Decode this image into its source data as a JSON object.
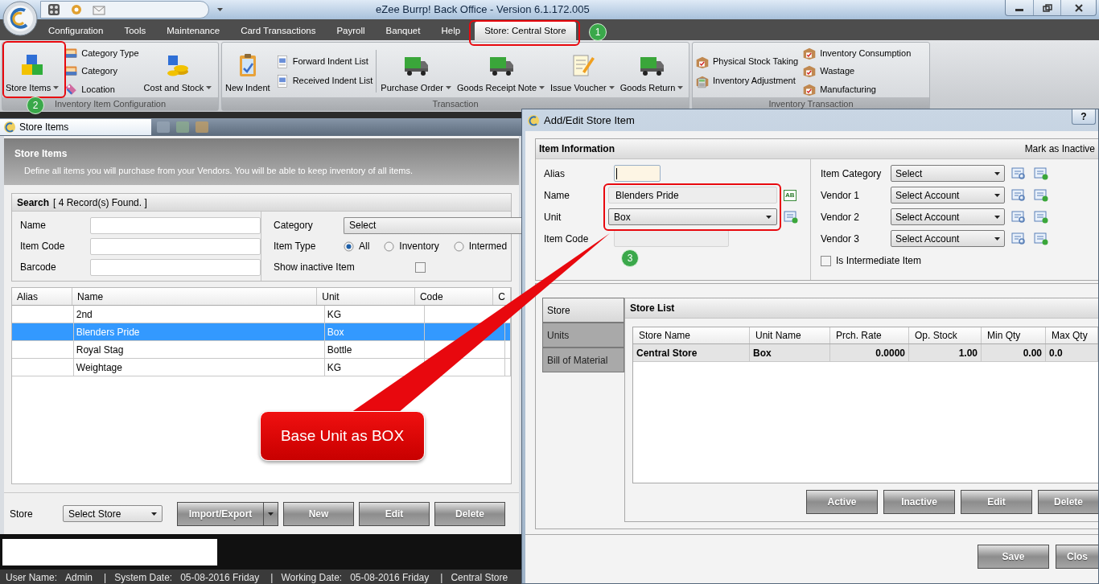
{
  "window": {
    "title": "eZee Burrp! Back Office - Version 6.1.172.005"
  },
  "menu_tabs": [
    {
      "label": "Configuration",
      "selected": false
    },
    {
      "label": "Tools",
      "selected": false
    },
    {
      "label": "Maintenance",
      "selected": false
    },
    {
      "label": "Card Transactions",
      "selected": false
    },
    {
      "label": "Payroll",
      "selected": false
    },
    {
      "label": "Banquet",
      "selected": false
    },
    {
      "label": "Help",
      "selected": false
    },
    {
      "label": "Store: Central Store",
      "selected": true
    }
  ],
  "ribbon_groups": [
    {
      "title": "Inventory Item Configuration",
      "columns": [
        {
          "kind": "large",
          "items": [
            {
              "label": "Store Items",
              "dropdown": true
            }
          ]
        },
        {
          "kind": "small",
          "items": [
            {
              "label": "Category Type",
              "dropdown": false
            },
            {
              "label": "Category",
              "dropdown": false
            },
            {
              "label": "Location",
              "dropdown": false
            }
          ]
        },
        {
          "kind": "large",
          "items": [
            {
              "label": "Cost and Stock",
              "dropdown": true
            }
          ]
        }
      ]
    },
    {
      "title": "Transaction",
      "columns": [
        {
          "kind": "large",
          "items": [
            {
              "label": "New Indent",
              "dropdown": false
            }
          ]
        },
        {
          "kind": "small",
          "items": [
            {
              "label": "Forward Indent List",
              "dropdown": false
            },
            {
              "label": "Received Indent List",
              "dropdown": false
            }
          ]
        },
        {
          "kind": "large",
          "items": [
            {
              "label": "Purchase Order",
              "dropdown": true
            }
          ]
        },
        {
          "kind": "large",
          "items": [
            {
              "label": "Goods Receipt Note",
              "dropdown": true
            }
          ]
        },
        {
          "kind": "large",
          "items": [
            {
              "label": "Issue Voucher",
              "dropdown": true
            }
          ]
        },
        {
          "kind": "large",
          "items": [
            {
              "label": "Goods Return",
              "dropdown": true
            }
          ]
        }
      ]
    },
    {
      "title": "Inventory Transaction",
      "columns": [
        {
          "kind": "small",
          "items": [
            {
              "label": "Physical Stock Taking",
              "dropdown": false
            },
            {
              "label": "Inventory Adjustment",
              "dropdown": false
            }
          ]
        },
        {
          "kind": "small",
          "items": [
            {
              "label": "Inventory Consumption",
              "dropdown": false
            },
            {
              "label": "Wastage",
              "dropdown": false
            },
            {
              "label": "Manufacturing",
              "dropdown": false
            }
          ]
        }
      ]
    }
  ],
  "store_items": {
    "title": "Store Items",
    "header_title": "Store Items",
    "header_description": "Define all items you will purchase from your Vendors. You will be able to keep inventory of all items.",
    "search": {
      "title": "Search",
      "count": "[ 4 Record(s) Found. ]",
      "fields": [
        {
          "label": "Name"
        },
        {
          "label": "Item Code"
        },
        {
          "label": "Barcode"
        }
      ],
      "category": {
        "label": "Category",
        "value": "Select"
      },
      "item_type": {
        "label": "Item Type",
        "options": [
          {
            "label": "All",
            "selected": true
          },
          {
            "label": "Inventory",
            "selected": false
          },
          {
            "label": "Intermed",
            "selected": false
          }
        ]
      },
      "show_inactive": {
        "label": "Show inactive Item",
        "checked": false
      }
    },
    "table": {
      "columns": [
        "Alias",
        "Name",
        "Unit",
        "Code",
        "C"
      ],
      "rows": [
        {
          "name": "2nd",
          "unit": "KG",
          "selected": false
        },
        {
          "name": "Blenders Pride",
          "unit": "Box",
          "selected": true
        },
        {
          "name": "Royal Stag",
          "unit": "Bottle",
          "selected": false
        },
        {
          "name": "Weightage",
          "unit": "KG",
          "selected": false
        }
      ]
    },
    "footer": {
      "store_label": "Store",
      "store_select": "Select Store",
      "buttons": [
        {
          "label": "Import/Export",
          "dropdown": true
        },
        {
          "label": "New",
          "dropdown": false
        },
        {
          "label": "Edit",
          "dropdown": false
        },
        {
          "label": "Delete",
          "dropdown": false
        }
      ]
    }
  },
  "status_bar": [
    {
      "kind": "field",
      "label": "User Name:",
      "value": "Admin"
    },
    {
      "kind": "separator",
      "text": "|"
    },
    {
      "kind": "field",
      "label": "System Date:",
      "value": "05-08-2016 Friday"
    },
    {
      "kind": "separator",
      "text": "|"
    },
    {
      "kind": "field",
      "label": "Working Date:",
      "value": "05-08-2016 Friday"
    },
    {
      "kind": "separator",
      "text": "|"
    },
    {
      "kind": "text",
      "text": "Central Store"
    }
  ],
  "dialog": {
    "title": "Add/Edit Store Item",
    "help": "?",
    "section_title": "Item Information",
    "mark_inactive": "Mark as Inactive",
    "left_fields": [
      {
        "label": "Alias",
        "kind": "text",
        "focused": true
      },
      {
        "label": "Name",
        "kind": "readonly",
        "value": "Blenders Pride",
        "action": "AB"
      },
      {
        "label": "Unit",
        "kind": "select",
        "value": "Box"
      },
      {
        "label": "Item Code",
        "kind": "readonly"
      }
    ],
    "right_fields": [
      {
        "label": "Item Category",
        "value": "Select"
      },
      {
        "label": "Vendor 1",
        "value": "Select Account"
      },
      {
        "label": "Vendor 2",
        "value": "Select Account"
      },
      {
        "label": "Vendor 3",
        "value": "Select Account"
      }
    ],
    "intermediate": {
      "label": "Is Intermediate Item",
      "checked": false
    },
    "side_tabs": [
      {
        "label": "Store",
        "selected": true
      },
      {
        "label": "Units",
        "selected": false
      },
      {
        "label": "Bill of Material",
        "selected": false
      }
    ],
    "store_list": {
      "title": "Store List",
      "columns": [
        "Store Name",
        "Unit Name",
        "Prch. Rate",
        "Op. Stock",
        "Min Qty",
        "Max Qty"
      ],
      "rows": [
        {
          "cells": [
            "Central Store",
            "Box",
            "0.0000",
            "1.00",
            "0.00",
            "0.0"
          ]
        }
      ]
    },
    "list_buttons": [
      "Active",
      "Inactive",
      "Edit",
      "Delete"
    ],
    "buttons": [
      "Save",
      "Clos"
    ]
  },
  "annotations": {
    "markers": [
      "1",
      "2",
      "3"
    ],
    "callout": "Base Unit as BOX"
  }
}
